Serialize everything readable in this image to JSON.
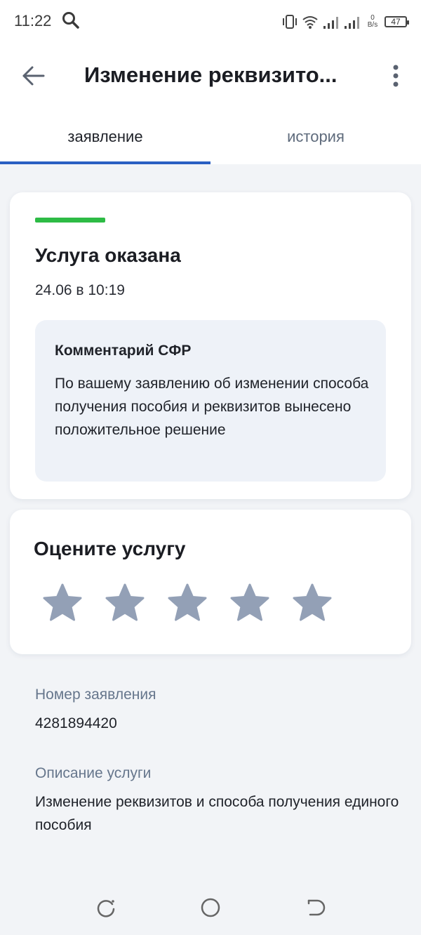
{
  "status_bar": {
    "time": "11:22",
    "net_speed_value": "0",
    "net_speed_unit": "B/s",
    "battery": "47"
  },
  "app_bar": {
    "title": "Изменение реквизито..."
  },
  "tabs": [
    {
      "label": "заявление",
      "active": true
    },
    {
      "label": "история",
      "active": false
    }
  ],
  "status_card": {
    "title": "Услуга оказана",
    "date": "24.06 в 10:19",
    "status_color": "#2dbb45",
    "comment": {
      "title": "Комментарий СФР",
      "text": "По вашему заявлению об изменении способа получения пособия и реквизитов вынесено положительное решение"
    }
  },
  "rating_card": {
    "title": "Оцените услугу",
    "stars_total": 5,
    "stars_selected": 0,
    "star_color": "#93a0b6"
  },
  "details": {
    "number_label": "Номер заявления",
    "number_value": "4281894420",
    "description_label": "Описание услуги",
    "description_value": "Изменение реквизитов и способа получения единого пособия"
  },
  "colors": {
    "accent": "#2a5fc2",
    "background": "#f2f4f7",
    "comment_bg": "#eef2f8",
    "muted_text": "#66768c"
  }
}
